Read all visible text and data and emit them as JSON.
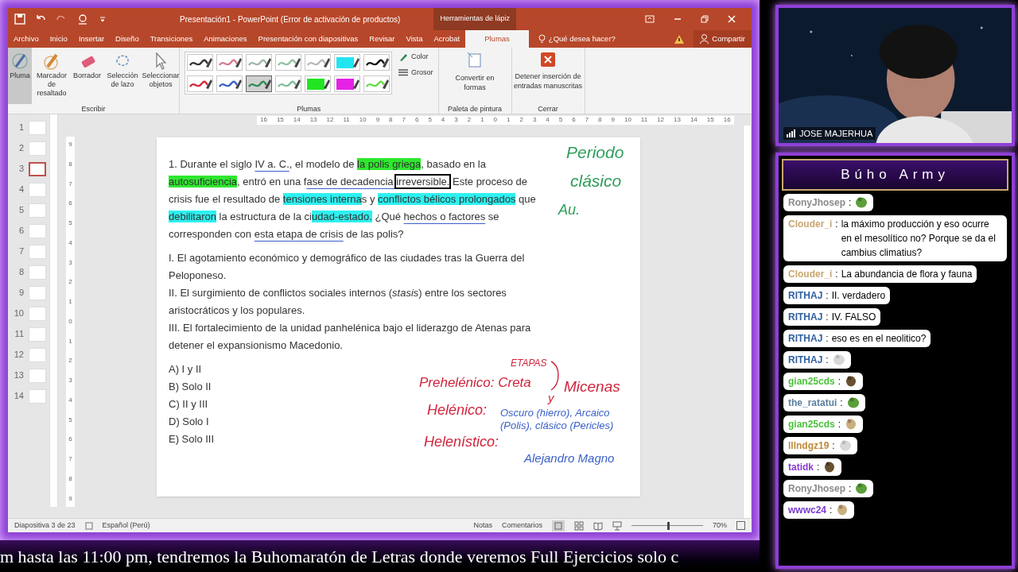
{
  "window": {
    "title": "Presentación1 - PowerPoint (Error de activación de productos)",
    "context_tab": "Herramientas de lápiz"
  },
  "menu_tabs": [
    {
      "label": "Archivo",
      "selected": false
    },
    {
      "label": "Inicio",
      "selected": false
    },
    {
      "label": "Insertar",
      "selected": false
    },
    {
      "label": "Diseño",
      "selected": false
    },
    {
      "label": "Transiciones",
      "selected": false
    },
    {
      "label": "Animaciones",
      "selected": false
    },
    {
      "label": "Presentación con diapositivas",
      "selected": false
    },
    {
      "label": "Revisar",
      "selected": false
    },
    {
      "label": "Vista",
      "selected": false
    },
    {
      "label": "Acrobat",
      "selected": false
    },
    {
      "label": "Plumas",
      "selected": true
    }
  ],
  "search": {
    "placeholder": "¿Qué desea hacer?"
  },
  "share": "Compartir",
  "ribbon": {
    "write_tools": [
      {
        "label": "Pluma",
        "selected": true
      },
      {
        "label": "Marcador de resaltado",
        "selected": false
      },
      {
        "label": "Borrador",
        "selected": false
      },
      {
        "label": "Selección de lazo",
        "selected": false
      },
      {
        "label": "Seleccionar objetos",
        "selected": false
      }
    ],
    "write_group": "Escribir",
    "pens": [
      {
        "kind": "pen",
        "color": "#333333",
        "selected": false
      },
      {
        "kind": "pen",
        "color": "#d67a90",
        "selected": false
      },
      {
        "kind": "pen",
        "color": "#9fb8a8",
        "selected": false
      },
      {
        "kind": "pen",
        "color": "#8fc4a0",
        "selected": false
      },
      {
        "kind": "pen",
        "color": "#b8b8b8",
        "selected": false
      },
      {
        "kind": "highlighter",
        "color": "#22e5f0",
        "selected": false
      },
      {
        "kind": "pen",
        "color": "#111111",
        "selected": false
      },
      {
        "kind": "pen",
        "color": "#d6283c",
        "selected": false
      },
      {
        "kind": "pen",
        "color": "#3a5fc8",
        "selected": false
      },
      {
        "kind": "pen",
        "color": "#2e8b57",
        "selected": true
      },
      {
        "kind": "pen",
        "color": "#7fbf9a",
        "selected": false
      },
      {
        "kind": "highlighter",
        "color": "#22e522",
        "selected": false
      },
      {
        "kind": "highlighter",
        "color": "#e522e5",
        "selected": false
      },
      {
        "kind": "pen",
        "color": "#66dd44",
        "selected": false
      }
    ],
    "color_label": "Color",
    "thickness_label": "Grosor",
    "pens_group": "Plumas",
    "convert": "Convertir en formas",
    "convert_group": "Paleta de pintura",
    "stop": "Detener inserción de entradas manuscritas",
    "close_group": "Cerrar"
  },
  "horizontal_ruler": [
    "16",
    "15",
    "14",
    "13",
    "12",
    "11",
    "10",
    "9",
    "8",
    "7",
    "6",
    "5",
    "4",
    "3",
    "2",
    "1",
    "0",
    "1",
    "2",
    "3",
    "4",
    "5",
    "6",
    "7",
    "8",
    "9",
    "10",
    "11",
    "12",
    "13",
    "14",
    "15",
    "16"
  ],
  "vertical_ruler": [
    "9",
    "8",
    "7",
    "6",
    "5",
    "4",
    "3",
    "2",
    "1",
    "0",
    "1",
    "2",
    "3",
    "4",
    "5",
    "6",
    "7",
    "8",
    "9"
  ],
  "thumbnails": [
    {
      "number": "1",
      "selected": false
    },
    {
      "number": "2",
      "selected": false
    },
    {
      "number": "3",
      "selected": true
    },
    {
      "number": "4",
      "selected": false
    },
    {
      "number": "5",
      "selected": false
    },
    {
      "number": "6",
      "selected": false
    },
    {
      "number": "7",
      "selected": false
    },
    {
      "number": "8",
      "selected": false
    },
    {
      "number": "9",
      "selected": false
    },
    {
      "number": "10",
      "selected": false
    },
    {
      "number": "11",
      "selected": false
    },
    {
      "number": "12",
      "selected": false
    },
    {
      "number": "13",
      "selected": false
    },
    {
      "number": "14",
      "selected": false
    }
  ],
  "slide": {
    "question": [
      {
        "text": "1. Durante el siglo ",
        "kind": "plain"
      },
      {
        "text": "IV a. C.",
        "kind": "underline"
      },
      {
        "text": ", el modelo de ",
        "kind": "plain"
      },
      {
        "text": "la polis griega",
        "kind": "green"
      },
      {
        "text": ", basado en la ",
        "kind": "plain"
      },
      {
        "text": "autosuficiencia",
        "kind": "green"
      },
      {
        "text": ", entró en una f",
        "kind": "plain"
      },
      {
        "text": "ase de decadencia ",
        "kind": "underline"
      },
      {
        "text": "irreversible.",
        "kind": "box"
      },
      {
        "text": " Este proceso de crisis fue el resultado de ",
        "kind": "plain"
      },
      {
        "text": "tensiones interna",
        "kind": "cyan"
      },
      {
        "text": "s y ",
        "kind": "plain"
      },
      {
        "text": "conflictos bélicos prolongados",
        "kind": "cyan"
      },
      {
        "text": " que ",
        "kind": "plain"
      },
      {
        "text": "debilitaron",
        "kind": "cyan"
      },
      {
        "text": " la estructura de la ci",
        "kind": "plain"
      },
      {
        "text": "udad-estado.",
        "kind": "cyan"
      },
      {
        "text": " ¿Qué ",
        "kind": "plain"
      },
      {
        "text": "hechos o factores",
        "kind": "underline"
      },
      {
        "text": " se corresponden con ",
        "kind": "plain"
      },
      {
        "text": "esta etapa de crisis",
        "kind": "underline"
      },
      {
        "text": " de las polis?",
        "kind": "plain"
      }
    ],
    "statements": [
      "I. El agotamiento económico y demográfico de las ciudades tras la Guerra del Peloponeso.",
      "II. El surgimiento de conflictos sociales internos (*stasis*) entre los sectores aristocráticos y los populares.",
      "III. El fortalecimiento de la unidad panhelénica bajo el liderazgo de Atenas para detener el expansionismo Macedonio."
    ],
    "options": [
      "A) I y II",
      "B) Solo II",
      "C) II y III",
      "D) Solo I",
      "E) Solo III"
    ],
    "ink": [
      {
        "text": "Periodo",
        "color": "#2e9e5a"
      },
      {
        "text": "clásico",
        "color": "#2e9e5a"
      },
      {
        "text": "Au.",
        "color": "#2e9e5a"
      },
      {
        "text": "ETAPAS",
        "color": "#d0243c"
      },
      {
        "text": "Prehelénico: Creta",
        "color": "#d0243c"
      },
      {
        "text": "y",
        "color": "#d0243c"
      },
      {
        "text": "Micenas",
        "color": "#d0243c"
      },
      {
        "text": "Helénico:",
        "color": "#d0243c"
      },
      {
        "text": "Oscuro (hierro), Arcaico",
        "color": "#3a5fc8"
      },
      {
        "text": "(Polis), clásico (Pericles)",
        "color": "#3a5fc8"
      },
      {
        "text": "Helenístico:",
        "color": "#d0243c"
      },
      {
        "text": "Alejandro Magno",
        "color": "#3a5fc8"
      }
    ]
  },
  "status_bar": {
    "slide": "Diapositiva 3 de 23",
    "language": "Español (Perú)",
    "notes": "Notas",
    "comments": "Comentarios",
    "zoom_slider": {
      "level": 0.5
    },
    "zoom": "70%"
  },
  "ticker": "m hasta las 11:00 pm, tendremos la Buhomaratón de Letras donde veremos Full Ejercicios solo c",
  "webcam": {
    "name": "JOSE MAJERHUA"
  },
  "chat": {
    "title": "Búho Army",
    "messages": [
      {
        "user": "RonyJhosep",
        "color": "#8a8a8a",
        "separator": ":",
        "kind": "emote"
      },
      {
        "user": "Clouder_i",
        "color": "#c8a670",
        "separator": ":",
        "kind": "text",
        "text": "la máximo producción y eso ocurre en el mesolítico no? Porque se da el cambius climatius?"
      },
      {
        "user": "Clouder_i",
        "color": "#c8a670",
        "separator": ":",
        "kind": "text",
        "text": "La abundancia de flora y fauna"
      },
      {
        "user": "RITHAJ",
        "color": "#2e5fa0",
        "separator": ":",
        "kind": "text",
        "text": "II. verdadero"
      },
      {
        "user": "RITHAJ",
        "color": "#2e5fa0",
        "separator": ":",
        "kind": "text",
        "text": "IV. FALSO"
      },
      {
        "user": "RITHAJ",
        "color": "#2e5fa0",
        "separator": ":",
        "kind": "text",
        "text": "eso es en el neolitico?"
      },
      {
        "user": "RITHAJ",
        "color": "#2e5fa0",
        "separator": ":",
        "kind": "emote"
      },
      {
        "user": "gian25cds",
        "color": "#4cc23c",
        "separator": ":",
        "kind": "emote"
      },
      {
        "user": "the_ratatui",
        "color": "#5a7ea0",
        "separator": ":",
        "kind": "emote"
      },
      {
        "user": "gian25cds",
        "color": "#4cc23c",
        "separator": ":",
        "kind": "emote"
      },
      {
        "user": "lllndgz19",
        "color": "#c08a3a",
        "separator": ":",
        "kind": "emote"
      },
      {
        "user": "tatidk",
        "color": "#8a3ad0",
        "separator": ":",
        "kind": "emote"
      },
      {
        "user": "RonyJhosep",
        "color": "#8a8a8a",
        "separator": ":",
        "kind": "emote"
      },
      {
        "user": "wwwc24",
        "color": "#7a3ad0",
        "separator": ":",
        "kind": "emote"
      }
    ]
  }
}
